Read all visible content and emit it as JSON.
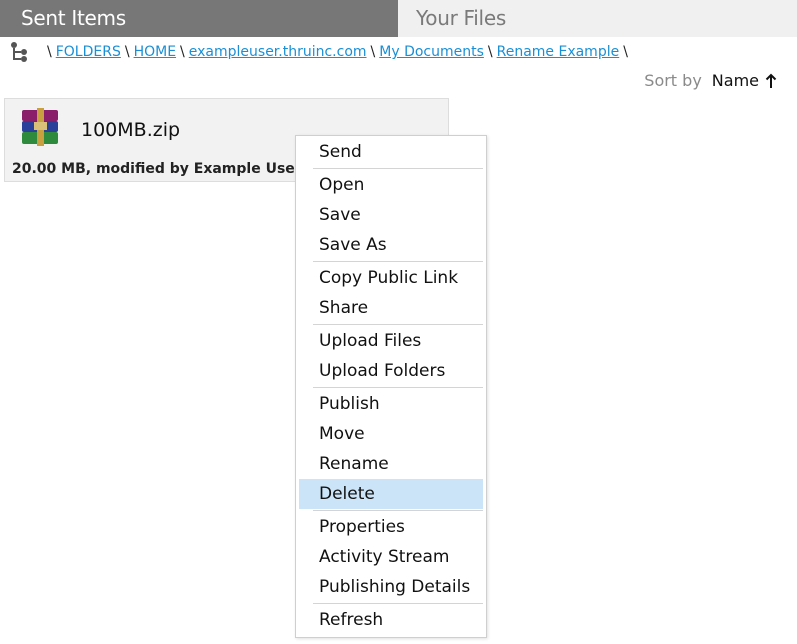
{
  "tabs": {
    "sent_items": "Sent Items",
    "your_files": "Your Files"
  },
  "breadcrumb": {
    "lead_sep": "\\",
    "items": [
      "FOLDERS",
      "HOME",
      "exampleuser.thruinc.com",
      "My Documents",
      "Rename Example"
    ],
    "sep": "\\"
  },
  "sort": {
    "label": "Sort by",
    "value": "Name",
    "direction": "ascending"
  },
  "file": {
    "name": "100MB.zip",
    "meta": "20.00 MB, modified by Example User on",
    "icon": "winrar-archive-icon"
  },
  "context_menu": {
    "groups": [
      [
        "Send"
      ],
      [
        "Open",
        "Save",
        "Save As"
      ],
      [
        "Copy Public Link",
        "Share"
      ],
      [
        "Upload Files",
        "Upload Folders"
      ],
      [
        "Publish",
        "Move",
        "Rename",
        "Delete"
      ],
      [
        "Properties",
        "Activity Stream",
        "Publishing Details"
      ],
      [
        "Refresh"
      ]
    ],
    "highlighted": "Delete"
  },
  "colors": {
    "accent_link": "#1a8fd6",
    "highlight": "#cce4f7",
    "active_tab": "#777777",
    "inactive_tab": "#f0f0f0"
  }
}
